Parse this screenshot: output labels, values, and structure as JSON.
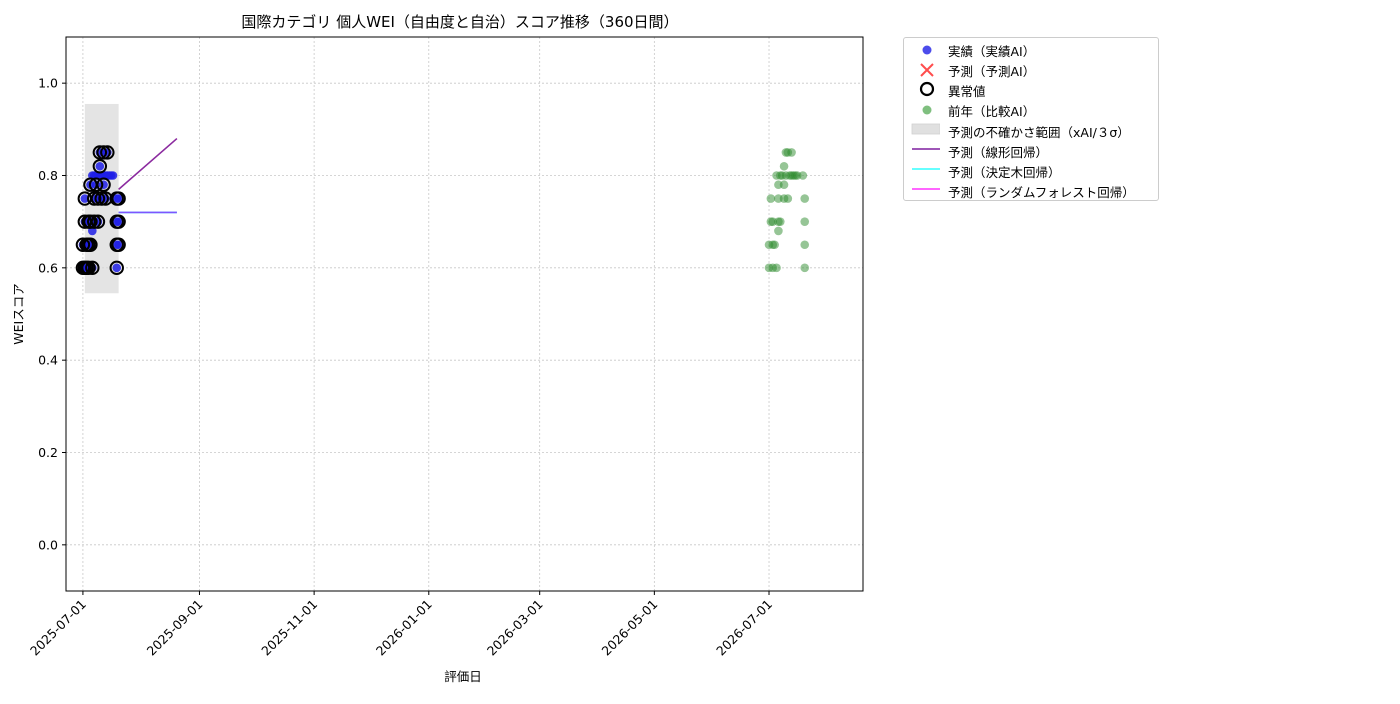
{
  "chart_data": {
    "type": "scatter",
    "title": "国際カテゴリ 個人WEI（自由度と自治）スコア推移（360日間）",
    "xlabel": "評価日",
    "ylabel": "WEIスコア",
    "x_axis_type": "date",
    "xlim": [
      "2025-06-22",
      "2026-08-20"
    ],
    "ylim": [
      -0.1,
      1.1
    ],
    "x_ticks": [
      "2025-07-01",
      "2025-09-01",
      "2025-11-01",
      "2026-01-01",
      "2026-03-01",
      "2026-05-01",
      "2026-07-01"
    ],
    "y_ticks": [
      0.0,
      0.2,
      0.4,
      0.6,
      0.8,
      1.0
    ],
    "grid": true,
    "legend_position": "outside-upper-right",
    "legend": [
      {
        "label": "実績（実績AI）",
        "marker": "dot",
        "color": "#1f1fe6"
      },
      {
        "label": "予測（予測AI）",
        "marker": "x",
        "color": "#ff3333"
      },
      {
        "label": "異常値",
        "marker": "ring",
        "color": "#000000"
      },
      {
        "label": "前年（比較AI）",
        "marker": "dot",
        "color": "#7fbf7f"
      },
      {
        "label": "予測の不確かさ範囲（xAI/３σ）",
        "marker": "band",
        "color": "#e0e0e0"
      },
      {
        "label": "予測（線形回帰）",
        "marker": "line",
        "color": "#7f1f9f"
      },
      {
        "label": "予測（決定木回帰）",
        "marker": "line",
        "color": "#33ffff"
      },
      {
        "label": "予測（ランダムフォレスト回帰）",
        "marker": "line",
        "color": "#ff33ff"
      }
    ],
    "series": [
      {
        "name": "実績（実績AI）",
        "kind": "scatter",
        "color": "#1f1fe6",
        "points": [
          [
            "2025-07-01",
            0.6
          ],
          [
            "2025-07-01",
            0.65
          ],
          [
            "2025-07-02",
            0.7
          ],
          [
            "2025-07-02",
            0.75
          ],
          [
            "2025-07-02",
            0.6
          ],
          [
            "2025-07-03",
            0.65
          ],
          [
            "2025-07-03",
            0.6
          ],
          [
            "2025-07-04",
            0.7
          ],
          [
            "2025-07-04",
            0.65
          ],
          [
            "2025-07-04",
            0.6
          ],
          [
            "2025-07-05",
            0.78
          ],
          [
            "2025-07-05",
            0.7
          ],
          [
            "2025-07-05",
            0.65
          ],
          [
            "2025-07-06",
            0.6
          ],
          [
            "2025-07-06",
            0.8
          ],
          [
            "2025-07-06",
            0.68
          ],
          [
            "2025-07-07",
            0.75
          ],
          [
            "2025-07-07",
            0.7
          ],
          [
            "2025-07-07",
            0.8
          ],
          [
            "2025-07-08",
            0.8
          ],
          [
            "2025-07-08",
            0.78
          ],
          [
            "2025-07-09",
            0.75
          ],
          [
            "2025-07-09",
            0.7
          ],
          [
            "2025-07-10",
            0.82
          ],
          [
            "2025-07-10",
            0.85
          ],
          [
            "2025-07-10",
            0.8
          ],
          [
            "2025-07-11",
            0.75
          ],
          [
            "2025-07-11",
            0.8
          ],
          [
            "2025-07-12",
            0.78
          ],
          [
            "2025-07-12",
            0.85
          ],
          [
            "2025-07-12",
            0.8
          ],
          [
            "2025-07-13",
            0.75
          ],
          [
            "2025-07-13",
            0.8
          ],
          [
            "2025-07-14",
            0.85
          ],
          [
            "2025-07-14",
            0.8
          ],
          [
            "2025-07-15",
            0.8
          ],
          [
            "2025-07-16",
            0.8
          ],
          [
            "2025-07-17",
            0.8
          ],
          [
            "2025-07-19",
            0.75
          ],
          [
            "2025-07-19",
            0.7
          ],
          [
            "2025-07-19",
            0.65
          ],
          [
            "2025-07-19",
            0.6
          ],
          [
            "2025-07-20",
            0.75
          ],
          [
            "2025-07-20",
            0.7
          ],
          [
            "2025-07-20",
            0.65
          ]
        ]
      },
      {
        "name": "異常値",
        "kind": "ring",
        "color": "#000000",
        "points": [
          [
            "2025-07-01",
            0.6
          ],
          [
            "2025-07-01",
            0.65
          ],
          [
            "2025-07-02",
            0.7
          ],
          [
            "2025-07-02",
            0.75
          ],
          [
            "2025-07-02",
            0.6
          ],
          [
            "2025-07-03",
            0.65
          ],
          [
            "2025-07-03",
            0.6
          ],
          [
            "2025-07-04",
            0.7
          ],
          [
            "2025-07-04",
            0.65
          ],
          [
            "2025-07-04",
            0.6
          ],
          [
            "2025-07-05",
            0.78
          ],
          [
            "2025-07-05",
            0.7
          ],
          [
            "2025-07-05",
            0.65
          ],
          [
            "2025-07-06",
            0.6
          ],
          [
            "2025-07-07",
            0.75
          ],
          [
            "2025-07-07",
            0.7
          ],
          [
            "2025-07-08",
            0.78
          ],
          [
            "2025-07-09",
            0.75
          ],
          [
            "2025-07-09",
            0.7
          ],
          [
            "2025-07-10",
            0.82
          ],
          [
            "2025-07-10",
            0.85
          ],
          [
            "2025-07-11",
            0.75
          ],
          [
            "2025-07-12",
            0.78
          ],
          [
            "2025-07-12",
            0.85
          ],
          [
            "2025-07-13",
            0.75
          ],
          [
            "2025-07-14",
            0.85
          ],
          [
            "2025-07-19",
            0.75
          ],
          [
            "2025-07-19",
            0.7
          ],
          [
            "2025-07-19",
            0.65
          ],
          [
            "2025-07-19",
            0.6
          ],
          [
            "2025-07-20",
            0.75
          ],
          [
            "2025-07-20",
            0.7
          ],
          [
            "2025-07-20",
            0.65
          ]
        ]
      },
      {
        "name": "前年（比較AI）",
        "kind": "scatter",
        "color": "#2e8b2e",
        "points": [
          [
            "2026-07-01",
            0.6
          ],
          [
            "2026-07-01",
            0.65
          ],
          [
            "2026-07-02",
            0.7
          ],
          [
            "2026-07-02",
            0.75
          ],
          [
            "2026-07-03",
            0.6
          ],
          [
            "2026-07-03",
            0.65
          ],
          [
            "2026-07-03",
            0.7
          ],
          [
            "2026-07-04",
            0.65
          ],
          [
            "2026-07-05",
            0.6
          ],
          [
            "2026-07-05",
            0.8
          ],
          [
            "2026-07-06",
            0.78
          ],
          [
            "2026-07-06",
            0.75
          ],
          [
            "2026-07-06",
            0.7
          ],
          [
            "2026-07-06",
            0.68
          ],
          [
            "2026-07-07",
            0.7
          ],
          [
            "2026-07-07",
            0.8
          ],
          [
            "2026-07-08",
            0.8
          ],
          [
            "2026-07-09",
            0.82
          ],
          [
            "2026-07-09",
            0.78
          ],
          [
            "2026-07-09",
            0.75
          ],
          [
            "2026-07-10",
            0.85
          ],
          [
            "2026-07-10",
            0.8
          ],
          [
            "2026-07-11",
            0.75
          ],
          [
            "2026-07-11",
            0.85
          ],
          [
            "2026-07-12",
            0.8
          ],
          [
            "2026-07-13",
            0.85
          ],
          [
            "2026-07-13",
            0.8
          ],
          [
            "2026-07-14",
            0.8
          ],
          [
            "2026-07-15",
            0.8
          ],
          [
            "2026-07-16",
            0.8
          ],
          [
            "2026-07-20",
            0.75
          ],
          [
            "2026-07-20",
            0.7
          ],
          [
            "2026-07-20",
            0.65
          ],
          [
            "2026-07-20",
            0.6
          ],
          [
            "2026-07-19",
            0.8
          ]
        ]
      },
      {
        "name": "予測（線形回帰）",
        "kind": "line",
        "color": "#8b2a9f",
        "points": [
          [
            "2025-07-20",
            0.77
          ],
          [
            "2025-08-20",
            0.88
          ]
        ]
      },
      {
        "name": "予測（決定木回帰）",
        "kind": "line",
        "color": "#33ffff",
        "points": [
          [
            "2025-07-20",
            0.72
          ],
          [
            "2025-08-20",
            0.72
          ]
        ]
      },
      {
        "name": "予測（ランダムフォレスト回帰）",
        "kind": "line",
        "color": "#7f55ff",
        "points": [
          [
            "2025-07-20",
            0.72
          ],
          [
            "2025-08-20",
            0.72
          ]
        ]
      }
    ],
    "uncertainty_band": {
      "x_start": "2025-07-02",
      "x_end": "2025-07-20",
      "y_low": 0.545,
      "y_high": 0.955,
      "color": "#d9d9d9"
    }
  }
}
